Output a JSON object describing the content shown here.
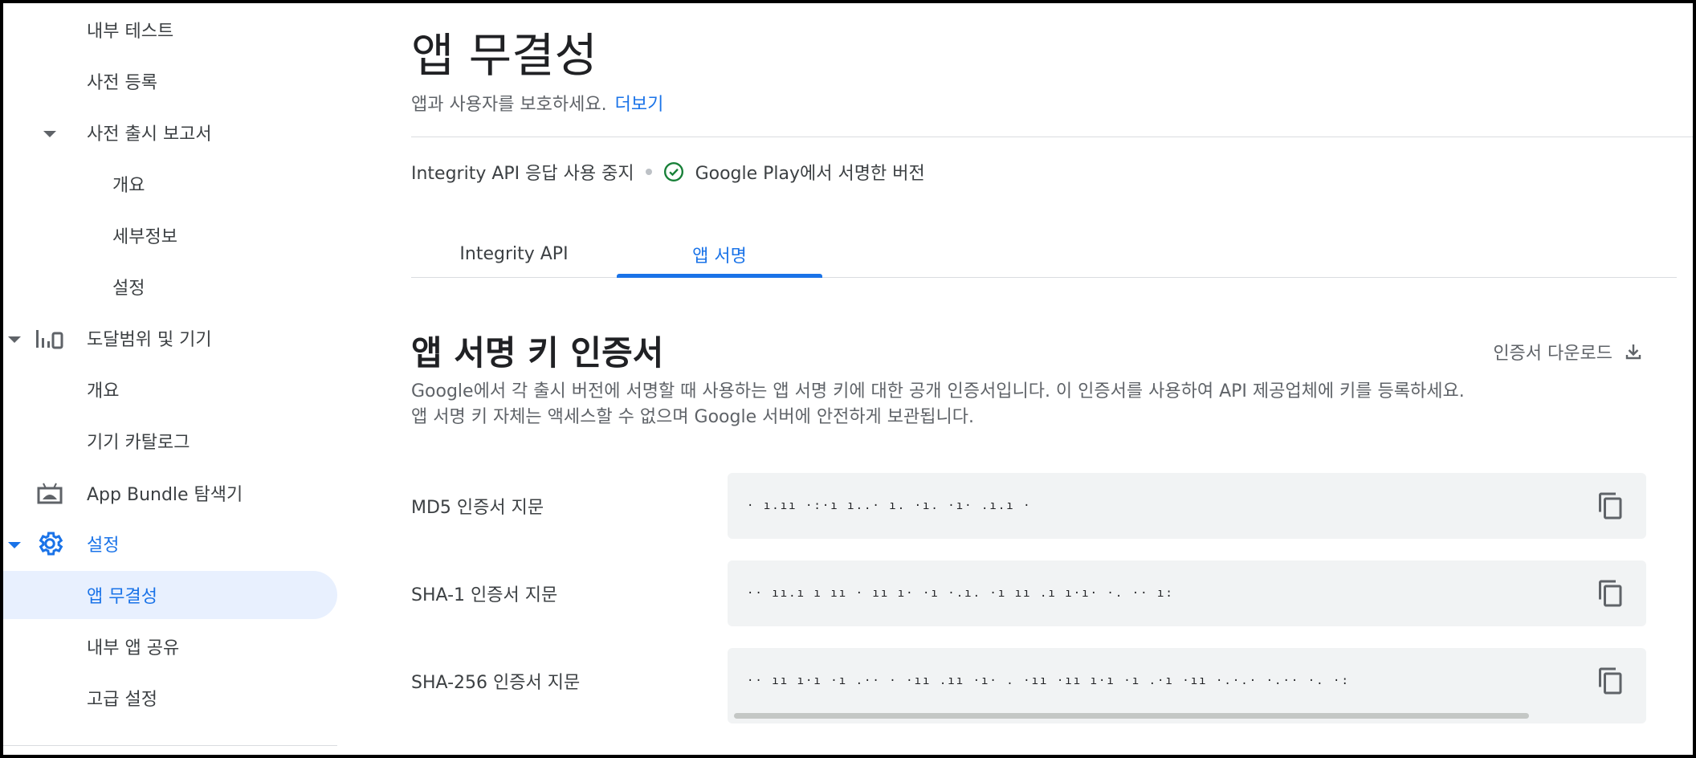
{
  "sidebar": {
    "items": [
      {
        "label": "내부 테스트"
      },
      {
        "label": "사전 등록"
      },
      {
        "label": "사전 출시 보고서"
      },
      {
        "label": "개요"
      },
      {
        "label": "세부정보"
      },
      {
        "label": "설정"
      },
      {
        "label": "도달범위 및 기기"
      },
      {
        "label": "개요"
      },
      {
        "label": "기기 카탈로그"
      },
      {
        "label": "App Bundle 탐색기"
      },
      {
        "label": "설정"
      },
      {
        "label": "앱 무결성"
      },
      {
        "label": "내부 앱 공유"
      },
      {
        "label": "고급 설정"
      }
    ]
  },
  "main": {
    "title": "앱 무결성",
    "subtitle": "앱과 사용자를 보호하세요.",
    "more_link": "더보기",
    "status": {
      "left": "Integrity API 응답 사용 중지",
      "right": "Google Play에서 서명한 버전"
    },
    "tabs": [
      {
        "label": "Integrity API"
      },
      {
        "label": "앱 서명"
      }
    ],
    "section": {
      "title": "앱 서명 키 인증서",
      "download_label": "인증서 다운로드",
      "desc_line1": "Google에서 각 출시 버전에 서명할 때 사용하는 앱 서명 키에 대한 공개 인증서입니다. 이 인증서를 사용하여 API 제공업체에 키를 등록하세요.",
      "desc_line2": "앱 서명 키 자체는 액세스할 수 없으며 Google 서버에 안전하게 보관됩니다."
    },
    "fingerprints": [
      {
        "label": "MD5 인증서 지문",
        "value": "· ı.ıı ·:·ı ı..· ı. ·ı. ·ı· .ı.ı ·"
      },
      {
        "label": "SHA-1 인증서 지문",
        "value": "·· ıı.ı ı ıı · ıı ı· ·ı ·.ı. ·ı ıı .ı ı·ı· ·. ·· ı:"
      },
      {
        "label": "SHA-256 인증서 지문",
        "value": "·· ıı ı·ı ·ı .·· · ·ıı .ıı ·ı· . ·ıı ·ıı ı·ı ·ı .·ı ·ıı ·.·.· ·.·· ·. ·:"
      }
    ]
  },
  "colors": {
    "accent": "#1a73e8",
    "active_bg": "#e8f0fe",
    "success": "#188038"
  },
  "icons": [
    "caret-down-icon",
    "bar-chart-icon",
    "android-bundle-icon",
    "gear-icon",
    "check-circle-icon",
    "download-icon",
    "copy-icon"
  ]
}
